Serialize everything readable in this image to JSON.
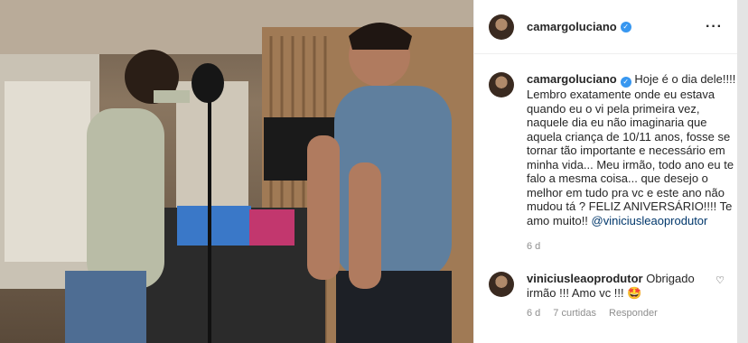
{
  "post": {
    "username": "camargoluciano",
    "caption_text": "Hoje é o dia dele!!!! Lembro exatamente onde eu estava quando eu o vi pela primeira vez, naquele dia eu não imaginaria que aquela criança de 10/11 anos, fosse se tornar tão importante e necessário em minha vida... Meu irmão, todo ano eu te falo a mesma coisa... que desejo o melhor em tudo pra vc e este ano não mudou tá ? FELIZ ANIVERSÁRIO!!!! Te amo muito!!",
    "mention": "@viniciusleaoprodutor",
    "age": "6 d"
  },
  "comment": {
    "username": "viniciusleaoprodutor",
    "text": "Obrigado irmão !!! Amo vc !!! 🤩",
    "age": "6 d",
    "likes": "7 curtidas",
    "reply": "Responder"
  },
  "icons": {
    "more": "more-options-icon",
    "verified": "verified-badge-icon",
    "like": "heart-icon"
  },
  "colors": {
    "verified": "#3897f0",
    "mention": "#00376b",
    "muted": "#8e8e8e"
  }
}
